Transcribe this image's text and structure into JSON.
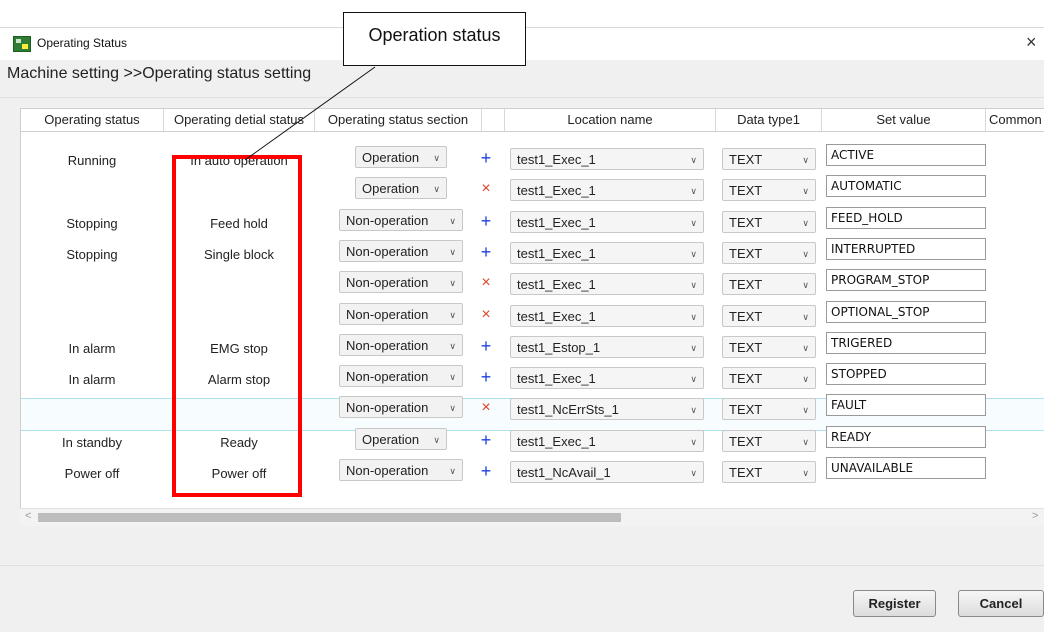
{
  "window": {
    "title": "Operating Status",
    "close_glyph": "×",
    "breadcrumb": "Machine setting >>Operating status setting"
  },
  "annotation": {
    "callout_label": "Operation status",
    "highlight_color": "#ff0000"
  },
  "grid": {
    "columns": [
      "Operating status",
      "Operating detial status",
      "Operating status section",
      "",
      "Location name",
      "Data type1",
      "Set value",
      "Common"
    ],
    "rows": [
      {
        "status": "Running",
        "detail": "In auto operation",
        "section": "Operation",
        "sign": "+",
        "location": "test1_Exec_1",
        "datatype": "TEXT",
        "setvalue": "ACTIVE"
      },
      {
        "status": "",
        "detail": "",
        "section": "Operation",
        "sign": "×",
        "location": "test1_Exec_1",
        "datatype": "TEXT",
        "setvalue": "AUTOMATIC"
      },
      {
        "status": "Stopping",
        "detail": "Feed hold",
        "section": "Non-operation",
        "sign": "+",
        "location": "test1_Exec_1",
        "datatype": "TEXT",
        "setvalue": "FEED_HOLD"
      },
      {
        "status": "Stopping",
        "detail": "Single block",
        "section": "Non-operation",
        "sign": "+",
        "location": "test1_Exec_1",
        "datatype": "TEXT",
        "setvalue": "INTERRUPTED"
      },
      {
        "status": "",
        "detail": "",
        "section": "Non-operation",
        "sign": "×",
        "location": "test1_Exec_1",
        "datatype": "TEXT",
        "setvalue": "PROGRAM_STOP"
      },
      {
        "status": "",
        "detail": "",
        "section": "Non-operation",
        "sign": "×",
        "location": "test1_Exec_1",
        "datatype": "TEXT",
        "setvalue": "OPTIONAL_STOP"
      },
      {
        "status": "In alarm",
        "detail": "EMG stop",
        "section": "Non-operation",
        "sign": "+",
        "location": "test1_Estop_1",
        "datatype": "TEXT",
        "setvalue": "TRIGERED"
      },
      {
        "status": "In alarm",
        "detail": "Alarm stop",
        "section": "Non-operation",
        "sign": "+",
        "location": "test1_Exec_1",
        "datatype": "TEXT",
        "setvalue": "STOPPED"
      },
      {
        "status": "",
        "detail": "",
        "section": "Non-operation",
        "sign": "×",
        "location": "test1_NcErrSts_1",
        "datatype": "TEXT",
        "setvalue": "FAULT"
      },
      {
        "status": "In standby",
        "detail": "Ready",
        "section": "Operation",
        "sign": "+",
        "location": "test1_Exec_1",
        "datatype": "TEXT",
        "setvalue": "READY"
      },
      {
        "status": "Power off",
        "detail": "Power off",
        "section": "Non-operation",
        "sign": "+",
        "location": "test1_NcAvail_1",
        "datatype": "TEXT",
        "setvalue": "UNAVAILABLE"
      }
    ]
  },
  "scrollbar": {
    "left_arrow": "<",
    "right_arrow": ">"
  },
  "footer": {
    "register_label": "Register",
    "cancel_label": "Cancel"
  },
  "icons": {
    "dropdown": "chevron-down-icon",
    "add": "plus-icon",
    "delete": "x-icon",
    "close": "close-icon"
  }
}
